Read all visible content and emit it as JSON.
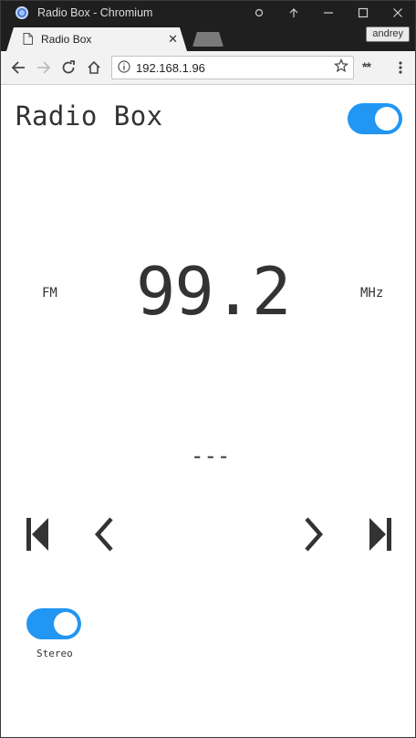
{
  "window": {
    "title": "Radio Box - Chromium",
    "controls": [
      "media-icon",
      "upload-icon",
      "minimize-icon",
      "maximize-icon",
      "close-icon"
    ]
  },
  "tabs": [
    {
      "label": "Radio Box",
      "active": true
    }
  ],
  "profile": {
    "name": "andrey"
  },
  "toolbar": {
    "url": "192.168.1.96",
    "extensions_label": "**"
  },
  "page": {
    "title": "Radio Box",
    "power_toggle": {
      "on": true
    },
    "band": "FM",
    "frequency": "99.2",
    "unit": "MHz",
    "station_name": "---",
    "controls": [
      "skip-back-icon",
      "chevron-left-icon",
      "chevron-right-icon",
      "skip-forward-icon"
    ],
    "stereo": {
      "label": "Stereo",
      "on": true
    }
  },
  "colors": {
    "accent": "#2196f3",
    "text": "#333333",
    "titlebar": "#1f1f1f"
  }
}
